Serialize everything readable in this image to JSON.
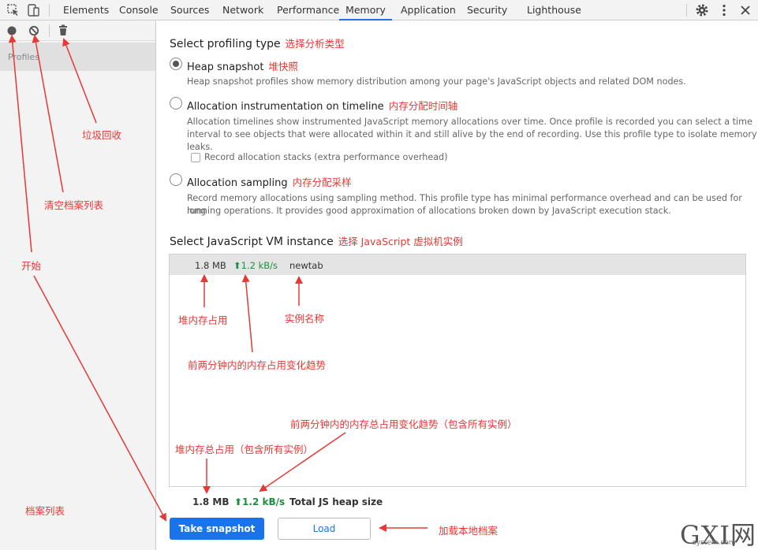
{
  "devtools": {
    "tabs": [
      "Elements",
      "Console",
      "Sources",
      "Network",
      "Performance",
      "Memory",
      "Application",
      "Security",
      "Lighthouse"
    ],
    "active_tab": "Memory",
    "accent": "#1a73e8"
  },
  "left_panel": {
    "profiles_label": "Profiles"
  },
  "main": {
    "profiling_title": "Select profiling type",
    "profiling_title_note": "选择分析类型",
    "options": [
      {
        "label": "Heap snapshot",
        "note": "堆快照",
        "checked": true,
        "description": "Heap snapshot profiles show memory distribution among your page's JavaScript objects and related DOM nodes."
      },
      {
        "label": "Allocation instrumentation on timeline",
        "note": "内存分配时间轴",
        "checked": false,
        "description_line1": "Allocation timelines show instrumented JavaScript memory allocations over time. Once profile is recorded you can select a time",
        "description_line2": "interval to see objects that were allocated within it and still alive by the end of recording. Use this profile type to isolate memory leaks.",
        "checkbox_label": "Record allocation stacks (extra performance overhead)"
      },
      {
        "label": "Allocation sampling",
        "note": "内存分配采样",
        "checked": false,
        "description_line1": "Record memory allocations using sampling method. This profile type has minimal performance overhead and can be used for long",
        "description_line2": "running operations. It provides good approximation of allocations broken down by JavaScript execution stack."
      }
    ],
    "vm_title": "Select JavaScript VM instance",
    "vm_title_note": "选择 JavaScript 虚拟机实例",
    "vm_instance": {
      "heap": "1.8 MB",
      "trend": "⬆1.2 kB/s",
      "name": "newtab"
    },
    "total": {
      "heap": "1.8 MB",
      "trend": "⬆1.2 kB/s",
      "label": "Total JS heap size"
    },
    "buttons": {
      "take_snapshot": "Take snapshot",
      "load": "Load"
    }
  },
  "annotations": {
    "garbage": "垃圾回收",
    "clear": "清空档案列表",
    "start": "开始",
    "profile_list": "档案列表",
    "heap_usage": "堆内存占用",
    "instance_name": "实例名称",
    "trend_2min": "前两分钟内的内存占用变化趋势",
    "total_trend": "前两分钟内的内存总占用变化趋势（包含所有实例）",
    "total_heap": "堆内存总占用（包含所有实例）",
    "load_local": "加载本地档案"
  },
  "watermark": {
    "text": "GXI网",
    "site": "system.com"
  }
}
